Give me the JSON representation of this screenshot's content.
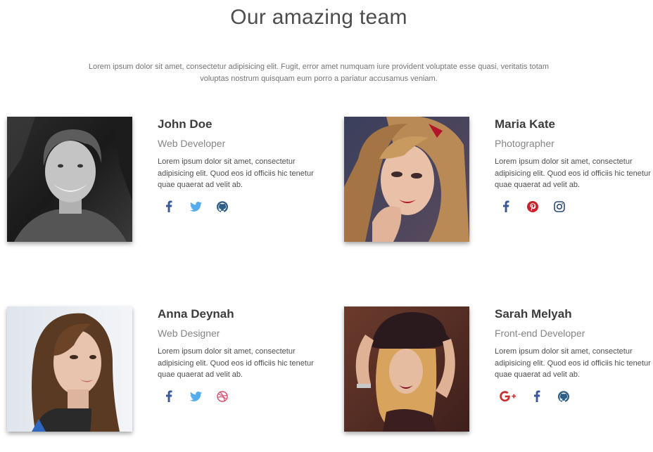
{
  "page": {
    "title": "Our amazing team",
    "intro": "Lorem ipsum dolor sit amet, consectetur adipisicing elit. Fugit, error amet numquam iure provident voluptate esse quasi, veritatis totam voluptas nostrum quisquam eum porro a pariatur accusamus veniam."
  },
  "colors": {
    "facebook": "#3b5998",
    "twitter": "#55acee",
    "github": "#333333",
    "pinterest": "#c92228",
    "instagram": "#2e5e86",
    "dribbble": "#ea4c89",
    "google_plus": "#dd4b39"
  },
  "members": [
    {
      "name": "John Doe",
      "role": "Web Developer",
      "bio": "Lorem ipsum dolor sit amet, consectetur adipisicing elit. Quod eos id officiis hic tenetur quae quaerat ad velit ab.",
      "socials": [
        "facebook-icon",
        "twitter-icon",
        "github-icon"
      ]
    },
    {
      "name": "Maria Kate",
      "role": "Photographer",
      "bio": "Lorem ipsum dolor sit amet, consectetur adipisicing elit. Quod eos id officiis hic tenetur quae quaerat ad velit ab.",
      "socials": [
        "facebook-icon",
        "pinterest-icon",
        "instagram-icon"
      ]
    },
    {
      "name": "Anna Deynah",
      "role": "Web Designer",
      "bio": "Lorem ipsum dolor sit amet, consectetur adipisicing elit. Quod eos id officiis hic tenetur quae quaerat ad velit ab.",
      "socials": [
        "facebook-icon",
        "twitter-icon",
        "dribbble-icon"
      ]
    },
    {
      "name": "Sarah Melyah",
      "role": "Front-end Developer",
      "bio": "Lorem ipsum dolor sit amet, consectetur adipisicing elit. Quod eos id officiis hic tenetur quae quaerat ad velit ab.",
      "socials": [
        "google-plus-icon",
        "facebook-icon",
        "github-icon"
      ]
    }
  ]
}
